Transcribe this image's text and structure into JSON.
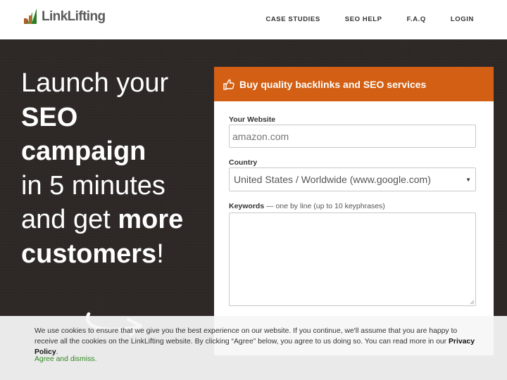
{
  "brand": {
    "name": "LinkLifting"
  },
  "nav": {
    "items": [
      "CASE STUDIES",
      "SEO HELP",
      "F.A.Q",
      "LOGIN"
    ]
  },
  "hero": {
    "line1": "Launch your",
    "line2": "SEO",
    "line3": "campaign",
    "line4": "in 5 minutes",
    "line5_pre": "and get ",
    "line5_bold": "more",
    "line6_bold": "customers",
    "line6_post": "!"
  },
  "form": {
    "title": "Buy quality backlinks and SEO services",
    "website": {
      "label": "Your Website",
      "placeholder": "amazon.com"
    },
    "country": {
      "label": "Country",
      "selected": "United States / Worldwide (www.google.com)"
    },
    "keywords": {
      "label": "Keywords",
      "note": " — one by line (up to 10 keyphrases)",
      "value": ""
    }
  },
  "cookie": {
    "text": "We use cookies to ensure that we give you the best experience on our website. If you continue, we'll assume that you are happy to receive all the cookies on the LinkLifting website. By clicking “Agree” below, you agree to us doing so. You can read more in our ",
    "policy_link": "Privacy Policy",
    "end": ".",
    "agree": "Agree and dismiss."
  },
  "colors": {
    "accent": "#d35f14",
    "hero_bg": "#2d2826",
    "link_green": "#2f8a1f",
    "logo_green": "#3a8c2f"
  },
  "icons": {
    "card_head": "thumbs-up-icon",
    "logo": "linklifting-logo-icon",
    "hero": "curved-arrow-icon",
    "select": "caret-down-icon"
  }
}
